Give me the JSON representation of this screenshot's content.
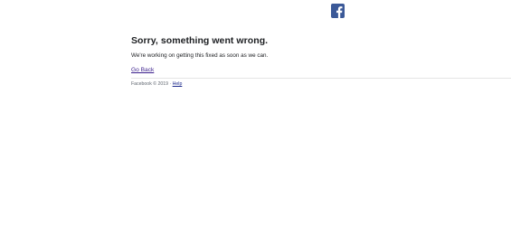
{
  "logo": {
    "icon": "facebook-f-logo-icon",
    "color": "#3b5998"
  },
  "error": {
    "heading": "Sorry, something went wrong.",
    "message": "We're working on getting this fixed as soon as we can.",
    "go_back_label": "Go Back"
  },
  "footer": {
    "copyright": "Facebook © 2019",
    "separator": " · ",
    "help_label": "Help"
  },
  "colors": {
    "link": "#3b1f8c",
    "text": "#1c1e21",
    "footer_text": "#606770"
  }
}
